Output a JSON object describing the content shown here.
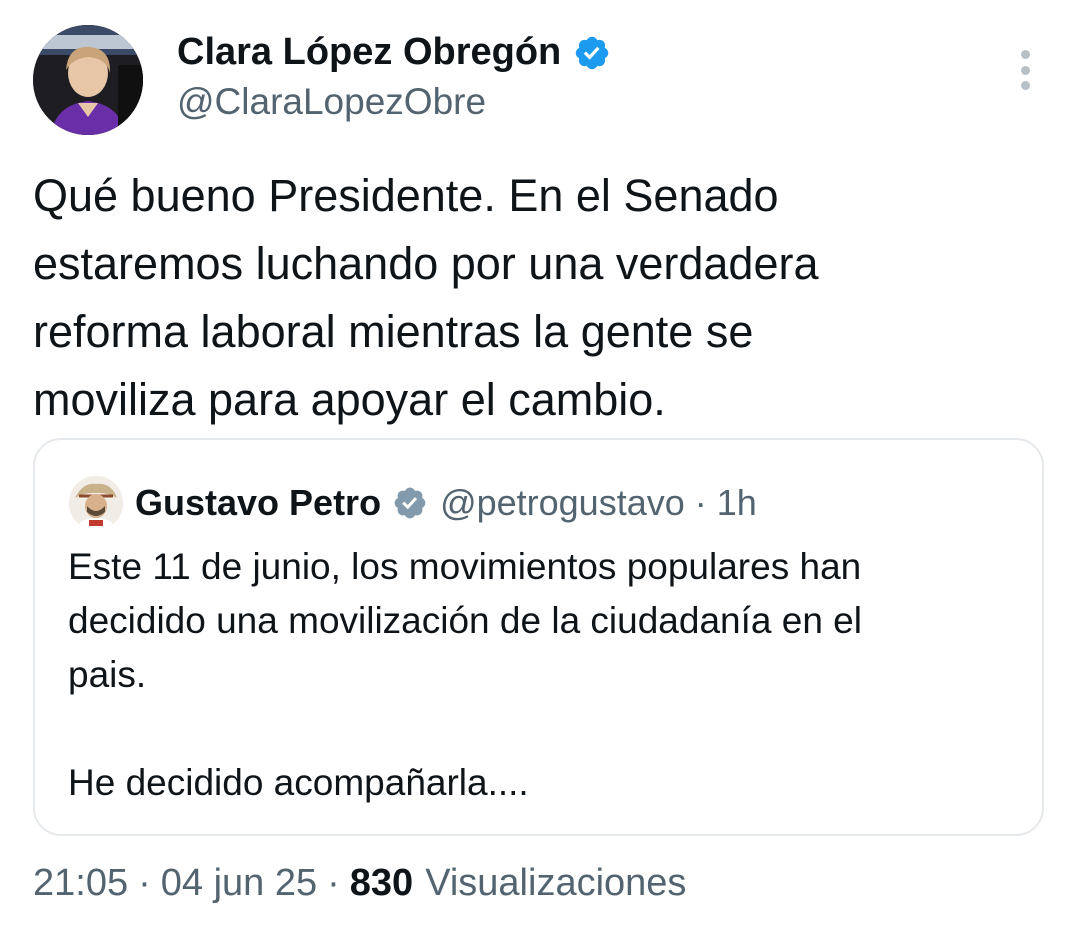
{
  "author": {
    "name": "Clara López Obregón",
    "handle": "@ClaraLopezObre",
    "verified_color": "#1d9bf0"
  },
  "tweet": {
    "lines": [
      "Qué bueno Presidente. En el Senado",
      "estaremos luchando por una verdadera",
      "reforma laboral mientras la gente se",
      "moviliza para apoyar el cambio."
    ]
  },
  "quote": {
    "name": "Gustavo Petro",
    "handle": "@petrogustavo",
    "separator": "·",
    "time": "1h",
    "verified_color": "#829aab",
    "lines": [
      "Este 11 de junio, los movimientos populares han",
      "decidido una movilización de la ciudadanía en el",
      "pais.",
      "",
      "He decidido acompañarla...."
    ]
  },
  "meta": {
    "time": "21:05",
    "separator": "·",
    "date": "04 jun 25",
    "views_count": "830",
    "views_label": "Visualizaciones"
  },
  "icons": {
    "more": "more-vertical-icon",
    "verified": "verified-badge-icon"
  }
}
